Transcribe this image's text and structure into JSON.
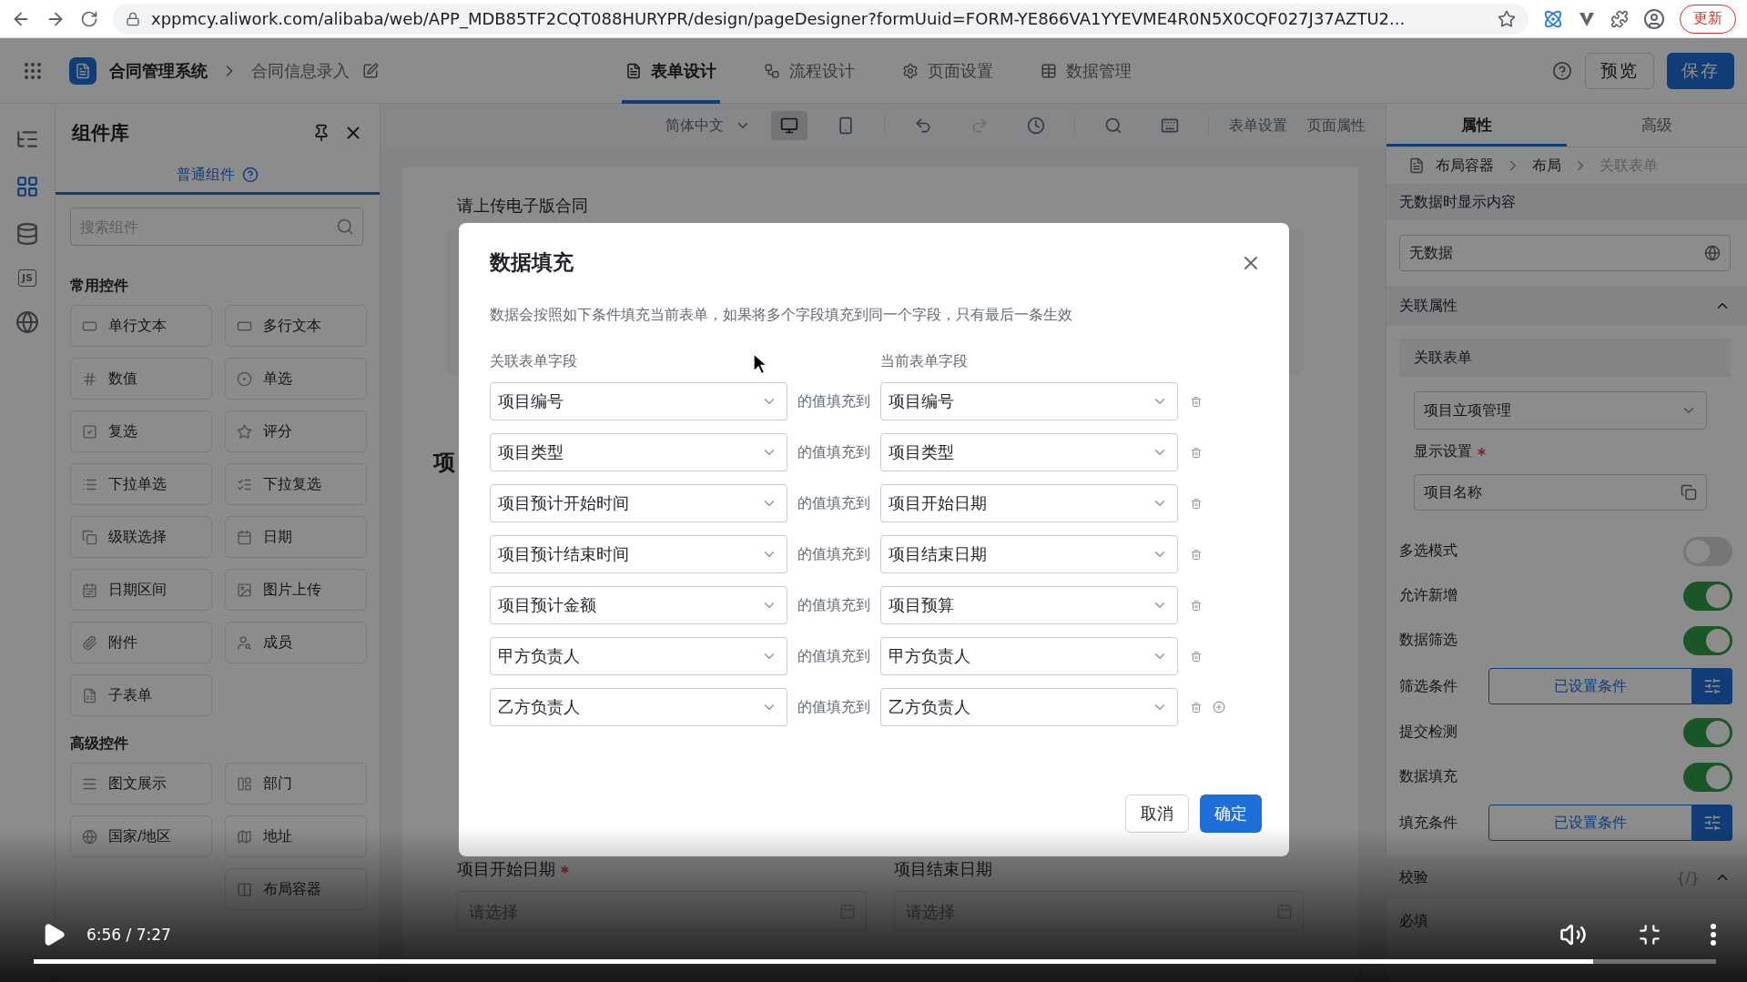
{
  "browser": {
    "url": "xppmcy.aliwork.com/alibaba/web/APP_MDB85TF2CQT088HURYPR/design/pageDesigner?formUuid=FORM-YE866VA1YYEVME4R0N5X0CQF027J37AZTU2...",
    "update_button": "更新"
  },
  "header": {
    "breadcrumb": [
      "合同管理系统",
      "合同信息录入"
    ],
    "tabs": [
      {
        "label": "表单设计",
        "kind": "form",
        "selected": true
      },
      {
        "label": "流程设计",
        "kind": "flow",
        "selected": false
      },
      {
        "label": "页面设置",
        "kind": "settings",
        "selected": false
      },
      {
        "label": "数据管理",
        "kind": "data",
        "selected": false
      }
    ],
    "actions": [
      {
        "label": "预览",
        "kind": "secondary"
      },
      {
        "label": "保存",
        "kind": "primary"
      }
    ]
  },
  "rail": [
    {
      "kind": "outline",
      "selected": false
    },
    {
      "kind": "components",
      "selected": true
    },
    {
      "kind": "datasource",
      "selected": false
    },
    {
      "kind": "script",
      "label": "JS",
      "selected": false
    },
    {
      "kind": "language",
      "selected": false
    }
  ],
  "component_panel": {
    "title": "组件库",
    "tabs": [
      {
        "label": "普通组件",
        "selected": true
      }
    ],
    "search": {
      "placeholder": "搜索组件"
    },
    "groups": [
      {
        "title": "常用控件",
        "items": [
          "单行文本",
          "多行文本",
          "数值",
          "单选",
          "复选",
          "评分",
          "下拉单选",
          "下拉复选",
          "级联选择",
          "日期",
          "日期区间",
          "图片上传",
          "附件",
          "成员",
          "子表单"
        ]
      },
      {
        "title": "高级控件",
        "items": [
          "图文展示",
          "部门",
          "国家/地区",
          "地址",
          "布局容器"
        ]
      }
    ]
  },
  "canvas": {
    "toolbar": {
      "language": "简体中文",
      "devices": [
        {
          "kind": "desktop",
          "selected": true
        },
        {
          "kind": "mobile",
          "selected": false
        }
      ],
      "history": [
        {
          "kind": "undo",
          "disabled": false
        },
        {
          "kind": "redo",
          "disabled": true
        }
      ],
      "links": [
        "表单设置",
        "页面属性"
      ]
    },
    "form": {
      "upload_label": "请上传电子版合同",
      "section_title": "项",
      "fields": [
        {
          "label": "项目开始日期",
          "required": true,
          "placeholder": "请选择"
        },
        {
          "label": "项目结束日期",
          "required": false,
          "placeholder": "请选择"
        }
      ]
    }
  },
  "properties_panel": {
    "tabs": [
      {
        "label": "属性",
        "selected": true
      },
      {
        "label": "高级",
        "selected": false
      }
    ],
    "breadcrumb": [
      "布局容器",
      "布局",
      "关联表单"
    ],
    "empty_text": {
      "title": "无数据时显示内容",
      "value": "无数据"
    },
    "association": {
      "title": "关联属性",
      "expanded": true,
      "form_label": "关联表单",
      "form_value": "项目立项管理",
      "display_label": "显示设置",
      "display_required": true,
      "display_value": "项目名称"
    },
    "settings": [
      {
        "kind": "toggle",
        "label": "多选模式",
        "on": false
      },
      {
        "kind": "toggle",
        "label": "允许新增",
        "on": true
      },
      {
        "kind": "toggle",
        "label": "数据筛选",
        "on": true
      },
      {
        "kind": "condition",
        "label": "筛选条件",
        "button": "已设置条件"
      },
      {
        "kind": "toggle",
        "label": "提交检测",
        "on": true
      },
      {
        "kind": "toggle",
        "label": "数据填充",
        "on": true
      },
      {
        "kind": "condition",
        "label": "填充条件",
        "button": "已设置条件"
      }
    ],
    "validation": {
      "title": "校验",
      "symbol": "{/}",
      "expanded": true,
      "first_rule": "必填"
    }
  },
  "dialog": {
    "title": "数据填充",
    "description": "数据会按照如下条件填充当前表单，如果将多个字段填充到同一个字段，只有最后一条生效",
    "source_heading": "关联表单字段",
    "target_heading": "当前表单字段",
    "mappings": [
      {
        "source": "项目编号",
        "connector": "的值填充到",
        "target": "项目编号"
      },
      {
        "source": "项目类型",
        "connector": "的值填充到",
        "target": "项目类型"
      },
      {
        "source": "项目预计开始时间",
        "connector": "的值填充到",
        "target": "项目开始日期"
      },
      {
        "source": "项目预计结束时间",
        "connector": "的值填充到",
        "target": "项目结束日期"
      },
      {
        "source": "项目预计金额",
        "connector": "的值填充到",
        "target": "项目预算"
      },
      {
        "source": "甲方负责人",
        "connector": "的值填充到",
        "target": "甲方负责人"
      },
      {
        "source": "乙方负责人",
        "connector": "的值填充到",
        "target": "乙方负责人"
      }
    ],
    "buttons": [
      {
        "label": "取消",
        "kind": "secondary"
      },
      {
        "label": "确定",
        "kind": "primary"
      }
    ]
  },
  "video": {
    "time": "6:56 / 7:27",
    "progress": {
      "level": 0.927
    }
  }
}
